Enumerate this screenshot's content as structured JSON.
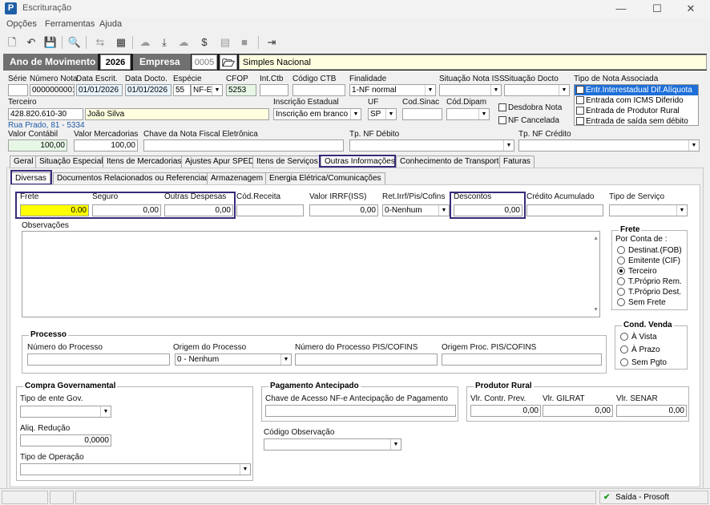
{
  "window": {
    "title": "Escrituração",
    "app_icon": "P",
    "min": "—",
    "max": "☐",
    "close": "✕"
  },
  "menu": [
    "Opções",
    "Ferramentas",
    "Ajuda"
  ],
  "icons": {
    "new": "🗋",
    "undo": "↶",
    "save": "💾",
    "preview": "🔍",
    "flow": "⇆",
    "calc": "▦",
    "cloud": "☁",
    "down": "⤓",
    "upload": "☁",
    "money": "$",
    "list": "▤",
    "box": "■",
    "exit": "⇥"
  },
  "header": {
    "ano_label": "Ano de Movimento",
    "ano": "2026",
    "empresa_label": "Empresa",
    "empresa_code": "0005",
    "empresa_name": "Simples Nacional"
  },
  "row1": {
    "serie_label": "Série",
    "serie": "",
    "numero_label": "Número Nota",
    "numero": "0000000001",
    "data_escrit_label": "Data Escrit.",
    "data_escrit": "01/01/2026",
    "data_docto_label": "Data Docto.",
    "data_docto": "01/01/2026",
    "especie_label": "Espécie",
    "especie_code": "55",
    "especie": "NF-E",
    "cfop_label": "CFOP",
    "cfop": "5253",
    "intctb_label": "Int.Ctb",
    "codctb_label": "Código CTB",
    "finalidade_label": "Finalidade",
    "finalidade": "1-NF normal",
    "sit_iss_label": "Situação Nota ISS",
    "sit_docto_label": "Situação Docto",
    "tipo_assoc_label": "Tipo de Nota Associada"
  },
  "tipo_assoc": [
    "Entr.Interestadual Dif.Alíquota",
    "Entrada com ICMS Diferido",
    "Entrada de Produtor Rural",
    "Entrada de saída sem débito"
  ],
  "row2": {
    "terceiro_label": "Terceiro",
    "terceiro_code": "428.820.610-30",
    "terceiro_name": "João Silva",
    "endereco": "Rua Prado, 81 - 5334",
    "ie_label": "Inscrição Estadual",
    "ie": "Inscrição em branco",
    "uf_label": "UF",
    "uf": "SP",
    "sinac_label": "Cod.Sinac",
    "dipam_label": "Cód.Dipam",
    "desdobra": "Desdobra Nota",
    "cancelada": "NF Cancelada"
  },
  "row3": {
    "valor_contabil_label": "Valor Contábil",
    "valor_contabil": "100,00",
    "valor_merc_label": "Valor Mercadorias",
    "valor_merc": "100,00",
    "chave_label": "Chave da Nota Fiscal Eletrônica",
    "tp_debito_label": "Tp. NF Débito",
    "tp_credito_label": "Tp. NF Crédito"
  },
  "tabs": [
    "Geral",
    "Situação Especial",
    "Itens de Mercadorias",
    "Ajustes Apur SPED",
    "Itens de Serviços",
    "Outras Informações",
    "Conhecimento de Transporte",
    "Faturas"
  ],
  "subtabs": [
    "Diversas",
    "Documentos Relacionados ou Referenciados",
    "Armazenagem",
    "Energia Elétrica/Comunicações"
  ],
  "diversas": {
    "frete_label": "Frete",
    "frete": "0.00",
    "seguro_label": "Seguro",
    "seguro": "0,00",
    "outras_label": "Outras Despesas",
    "outras": "0,00",
    "codrec_label": "Cód.Receita",
    "irrf_label": "Valor IRRF(ISS)",
    "irrf": "0,00",
    "ret_label": "Ret.Irrf/Pis/Cofins",
    "ret": "0-Nenhum",
    "desc_label": "Descontos",
    "desc": "0,00",
    "credito_label": "Crédito Acumulado",
    "tiposerv_label": "Tipo de Serviço",
    "obs_label": "Observações"
  },
  "frete_group": {
    "title": "Frete",
    "por_conta": "Por Conta de :",
    "options": [
      "Destinat.(FOB)",
      "Emitente (CIF)",
      "Terceiro",
      "T.Próprio Rem.",
      "T.Próprio Dest.",
      "Sem Frete"
    ]
  },
  "processo": {
    "title": "Processo",
    "numero_label": "Número do Processo",
    "origem_label": "Origem do Processo",
    "origem": "0 - Nenhum",
    "numero_pis_label": "Número do Processo PIS/COFINS",
    "origem_pis_label": "Origem Proc. PIS/COFINS"
  },
  "cond_venda": {
    "title": "Cond. Venda",
    "options": [
      "À Vista",
      "À Prazo",
      "Sem Pgto"
    ]
  },
  "compra": {
    "title": "Compra Governamental",
    "tipo_ente_label": "Tipo de ente Gov.",
    "aliq_label": "Aliq. Redução",
    "aliq": "0,0000",
    "tipo_op_label": "Tipo de Operação"
  },
  "pagamento": {
    "title": "Pagamento Antecipado",
    "chave_label": "Chave de Acesso NF-e Antecipação de Pagamento",
    "codobs_label": "Código Observação"
  },
  "produtor": {
    "title": "Produtor Rural",
    "contr_label": "Vlr. Contr. Prev.",
    "contr": "0,00",
    "gilrat_label": "Vlr. GILRAT",
    "gilrat": "0,00",
    "senar_label": "Vlr. SENAR",
    "senar": "0,00"
  },
  "status": {
    "text": "Saída - Prosoft",
    "check": "✔"
  },
  "colors": {
    "highlight": "#3a2a7a",
    "frete_bg": "#ffff00",
    "selected": "#1e6fd9"
  }
}
